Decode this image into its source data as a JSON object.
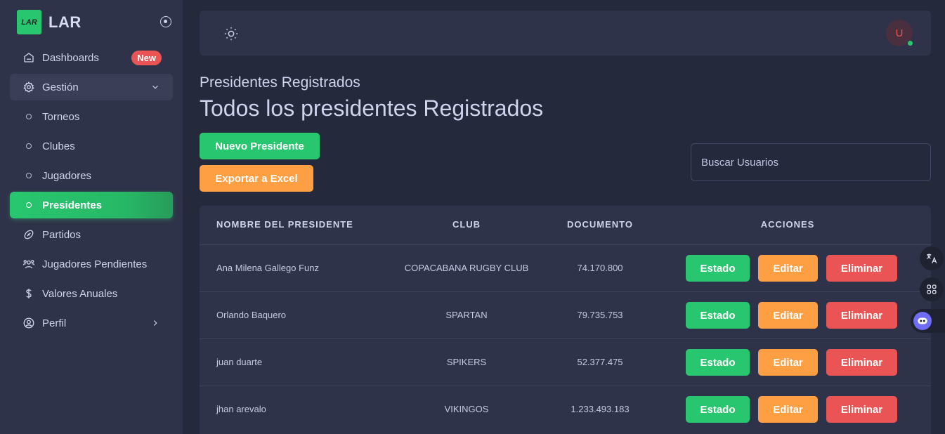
{
  "brand": {
    "logo_text": "LAR",
    "name": "LAR"
  },
  "sidebar": {
    "items": [
      {
        "label": "Dashboards",
        "badge": "New",
        "icon": "home-icon"
      },
      {
        "label": "Gestión",
        "icon": "gear-icon",
        "expanded": true
      },
      {
        "label": "Torneos",
        "sub": true
      },
      {
        "label": "Clubes",
        "sub": true
      },
      {
        "label": "Jugadores",
        "sub": true
      },
      {
        "label": "Presidentes",
        "sub": true,
        "active": true
      },
      {
        "label": "Partidos",
        "icon": "football-icon"
      },
      {
        "label": "Jugadores Pendientes",
        "icon": "users-icon"
      },
      {
        "label": "Valores Anuales",
        "icon": "dollar-icon"
      },
      {
        "label": "Perfil",
        "icon": "user-circle-icon"
      }
    ]
  },
  "topbar": {
    "avatar_initial": "U"
  },
  "page": {
    "subtitle": "Presidentes Registrados",
    "title": "Todos los presidentes Registrados",
    "new_button": "Nuevo Presidente",
    "export_button": "Exportar a Excel",
    "search_placeholder": "Buscar Usuarios"
  },
  "table": {
    "headers": [
      "NOMBRE DEL PRESIDENTE",
      "CLUB",
      "DOCUMENTO",
      "ACCIONES"
    ],
    "actions": {
      "status": "Estado",
      "edit": "Editar",
      "delete": "Eliminar"
    },
    "rows": [
      {
        "name": "Ana Milena Gallego Funz",
        "club": "COPACABANA RUGBY CLUB",
        "document": "74.170.800"
      },
      {
        "name": "Orlando Baquero",
        "club": "SPARTAN",
        "document": "79.735.753"
      },
      {
        "name": "juan duarte",
        "club": "SPIKERS",
        "document": "52.377.475"
      },
      {
        "name": "jhan arevalo",
        "club": "VIKINGOS",
        "document": "1.233.493.183"
      }
    ]
  },
  "colors": {
    "primary_green": "#28c76f",
    "warning_orange": "#ff9f43",
    "danger_red": "#ea5455",
    "background": "#25293c",
    "card": "#2f3349"
  }
}
